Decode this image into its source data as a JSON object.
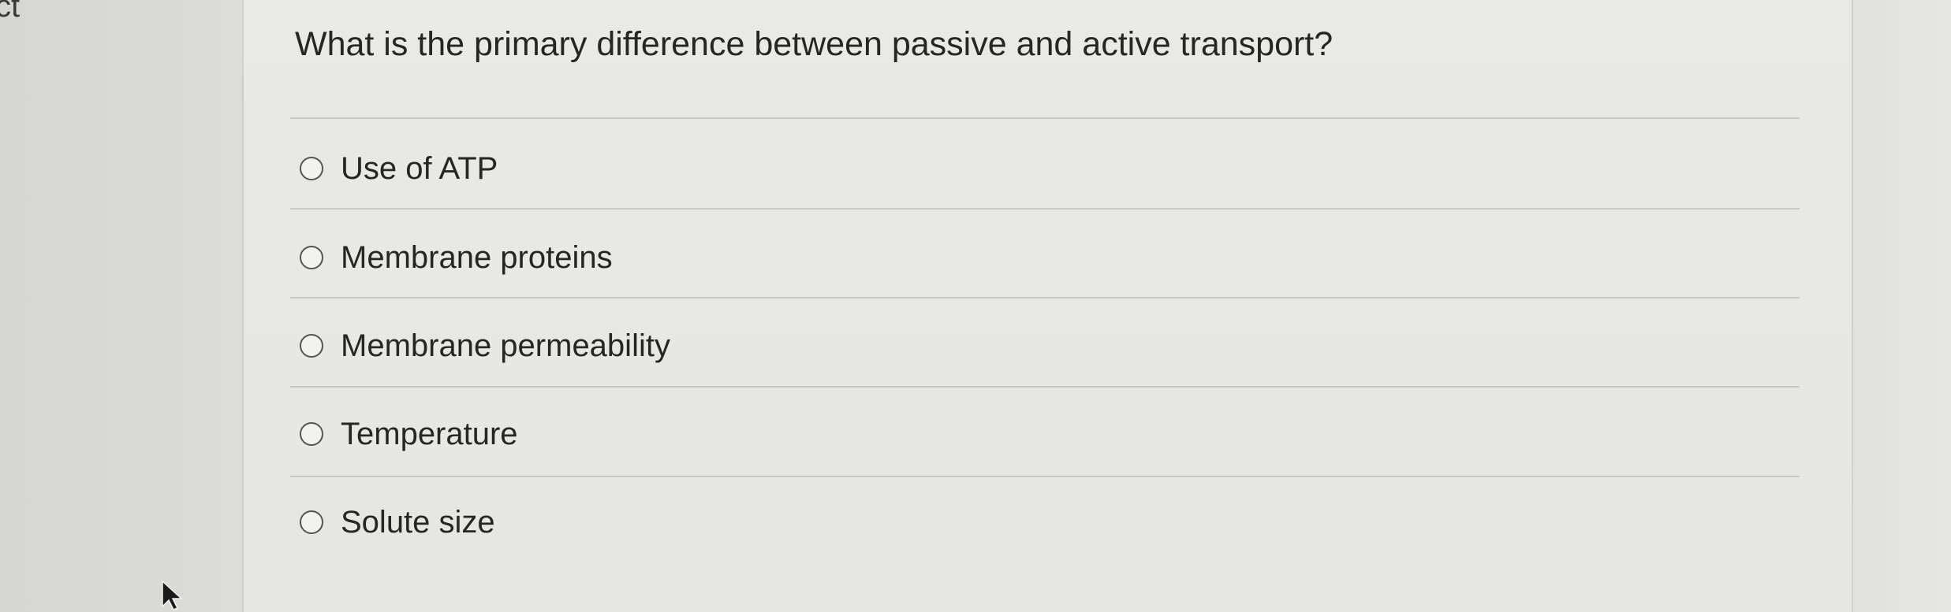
{
  "corner": {
    "text": "ct"
  },
  "question": {
    "text": "What is the primary difference between passive and active transport?"
  },
  "options": [
    {
      "label": "Use of ATP"
    },
    {
      "label": "Membrane proteins"
    },
    {
      "label": "Membrane permeability"
    },
    {
      "label": "Temperature"
    },
    {
      "label": "Solute size"
    }
  ],
  "icons": {
    "cursor": "mouse-pointer-icon",
    "radio": "radio-unselected-icon"
  }
}
